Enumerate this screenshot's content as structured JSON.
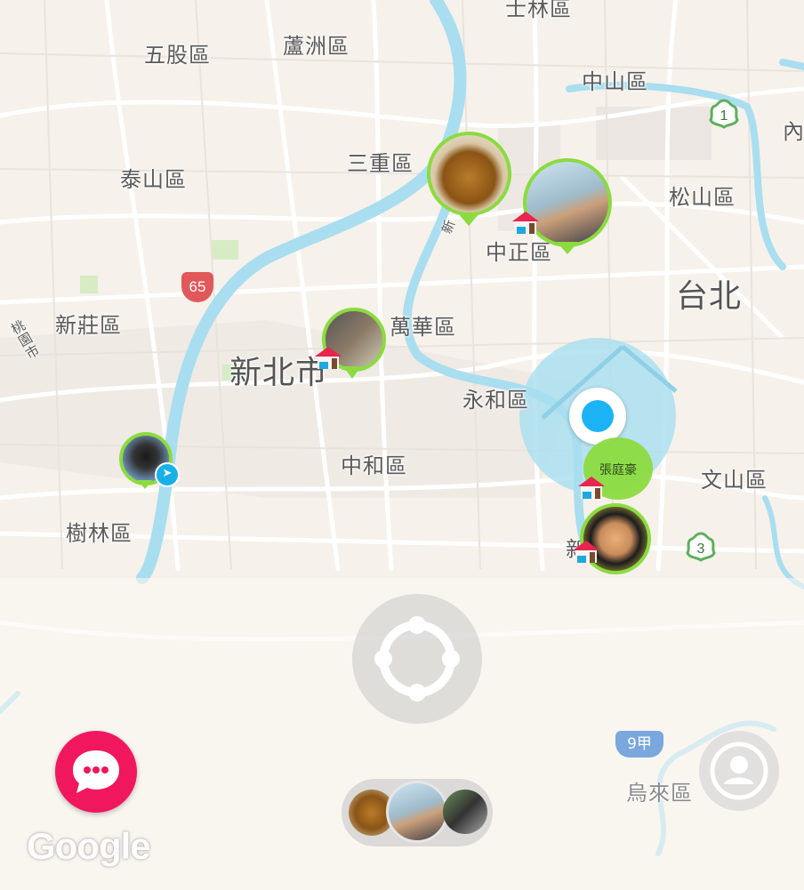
{
  "map": {
    "districts": [
      {
        "key": "wugu",
        "name": "五股區"
      },
      {
        "key": "luzhou",
        "name": "蘆洲區"
      },
      {
        "key": "shilin",
        "name": "士林區"
      },
      {
        "key": "zhongshan",
        "name": "中山區"
      },
      {
        "key": "neihu",
        "name": "內"
      },
      {
        "key": "taishan",
        "name": "泰山區"
      },
      {
        "key": "sanchong",
        "name": "三重區"
      },
      {
        "key": "songshan",
        "name": "松山區"
      },
      {
        "key": "zhongzheng",
        "name": "中正區"
      },
      {
        "key": "taipei",
        "name": "台北"
      },
      {
        "key": "xinzhuang",
        "name": "新莊區"
      },
      {
        "key": "wanhua",
        "name": "萬華區"
      },
      {
        "key": "xinbei",
        "name": "新北市"
      },
      {
        "key": "yonghe",
        "name": "永和區"
      },
      {
        "key": "zhonghe",
        "name": "中和區"
      },
      {
        "key": "wenshan",
        "name": "文山區"
      },
      {
        "key": "shulin",
        "name": "樹林區"
      },
      {
        "key": "wulai",
        "name": "烏來區"
      },
      {
        "key": "taoyuan",
        "name": "桃園市"
      },
      {
        "key": "xin_road",
        "name": "新"
      },
      {
        "key": "xin2",
        "name": "新"
      }
    ],
    "shields": {
      "route65": "65",
      "route9a": "9甲",
      "flower1": "1",
      "flower3": "3"
    },
    "user_bubble_name": "張庭豪",
    "attribution": "Google"
  },
  "colors": {
    "pin_border": "#8bdb3f",
    "water": "#a8def0",
    "location_dot": "#1bb3f5",
    "chat_button": "#f0175e"
  }
}
